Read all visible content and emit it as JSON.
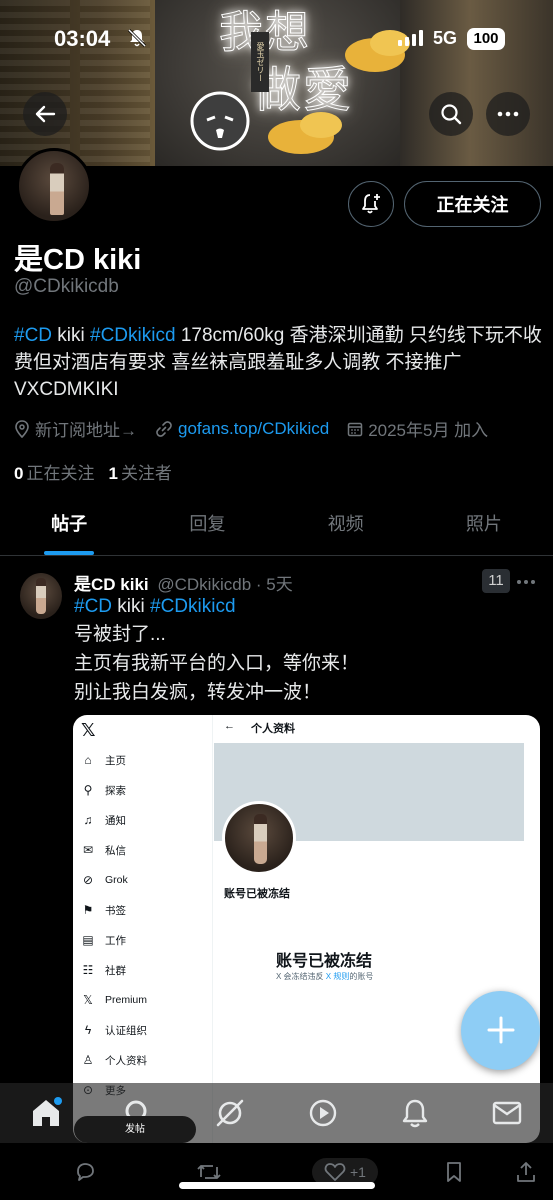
{
  "status_bar": {
    "time": "03:04",
    "network": "5G",
    "battery": "100"
  },
  "banner": {
    "neon_line1": "我想",
    "neon_line2": "做愛",
    "sign_text": "愛玉ゼリー"
  },
  "profile": {
    "following_button": "正在关注",
    "name": "是CD kiki",
    "handle": "@CDkikicdb",
    "bio_tag1": "#CD",
    "bio_word": " kiki ",
    "bio_tag2": "#CDkikicd",
    "bio_text": " 178cm/60kg 香港深圳通勤 只约线下玩不收费但对酒店有要求 喜丝袜高跟羞耻多人调教 不接推广VXCDMKIKI",
    "location": "新订阅地址→",
    "website": "gofans.top/CDkikicd",
    "joined": "2025年5月 加入",
    "following_count": "0",
    "following_label": "正在关注",
    "followers_count": "1",
    "followers_label": "关注者"
  },
  "tabs": [
    "帖子",
    "回复",
    "视频",
    "照片"
  ],
  "tweet": {
    "name": "是CD kiki",
    "handle": "@CDkikicdb",
    "time": "· 5天",
    "badge": "11",
    "tag1": "#CD",
    "word": " kiki ",
    "tag2": "#CDkikicd",
    "line1": "号被封了...",
    "line2": "主页有我新平台的入口，等你来！",
    "line3": "别让我白发疯，转发冲一波！"
  },
  "embedded": {
    "nav": [
      {
        "icon": "home-icon",
        "label": "主页"
      },
      {
        "icon": "search-icon",
        "label": "探索"
      },
      {
        "icon": "bell-icon",
        "label": "通知"
      },
      {
        "icon": "mail-icon",
        "label": "私信"
      },
      {
        "icon": "grok-icon",
        "label": "Grok"
      },
      {
        "icon": "bookmark-icon",
        "label": "书签"
      },
      {
        "icon": "briefcase-icon",
        "label": "工作"
      },
      {
        "icon": "community-icon",
        "label": "社群"
      },
      {
        "icon": "x-icon",
        "label": "Premium"
      },
      {
        "icon": "bolt-icon",
        "label": "认证组织"
      },
      {
        "icon": "person-icon",
        "label": "个人资料"
      },
      {
        "icon": "more-icon",
        "label": "更多"
      }
    ],
    "top_title": "个人资料",
    "frozen_name": "账号已被冻结",
    "frozen_title": "账号已被冻结",
    "frozen_sub_a": "X 会冻结违反 ",
    "frozen_sub_link": "X 规则",
    "frozen_sub_b": "的账号",
    "post_button": "发帖"
  },
  "actions": {
    "like_count": "+1"
  },
  "colors": {
    "accent": "#1d9bf0",
    "background": "#000000",
    "muted": "#71767b",
    "fab": "#8ecdf5"
  }
}
